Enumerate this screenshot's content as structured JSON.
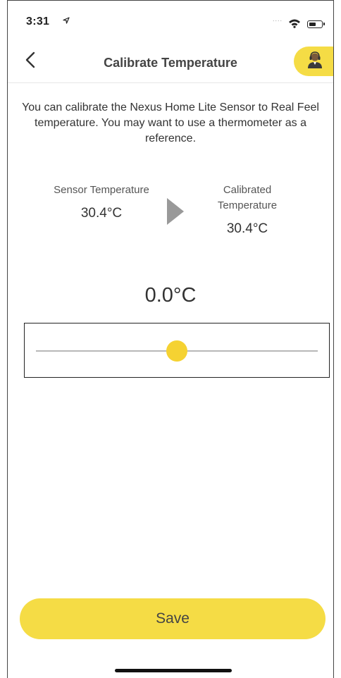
{
  "status_bar": {
    "time": "3:31",
    "location_icon": "location-arrow-icon",
    "signal_dots": "....",
    "wifi_icon": "wifi-icon",
    "battery_icon": "battery-icon"
  },
  "nav": {
    "back_icon": "chevron-left-icon",
    "title": "Calibrate Temperature",
    "support_icon": "support-agent-icon"
  },
  "intro": "You can calibrate the Nexus Home Lite Sensor to Real Feel temperature. You may want to use a thermometer as a reference.",
  "sensor": {
    "label": "Sensor Temperature",
    "value": "30.4°C"
  },
  "arrow_icon": "play-arrow-icon",
  "calibrated": {
    "label": "Calibrated Temperature",
    "value": "30.4°C"
  },
  "offset": {
    "display": "0.0°C",
    "slider_position": 0.5
  },
  "save_label": "Save",
  "colors": {
    "accent": "#f5dc45",
    "thumb": "#f5d232",
    "track": "#b7b7b7",
    "arrow": "#999999"
  }
}
